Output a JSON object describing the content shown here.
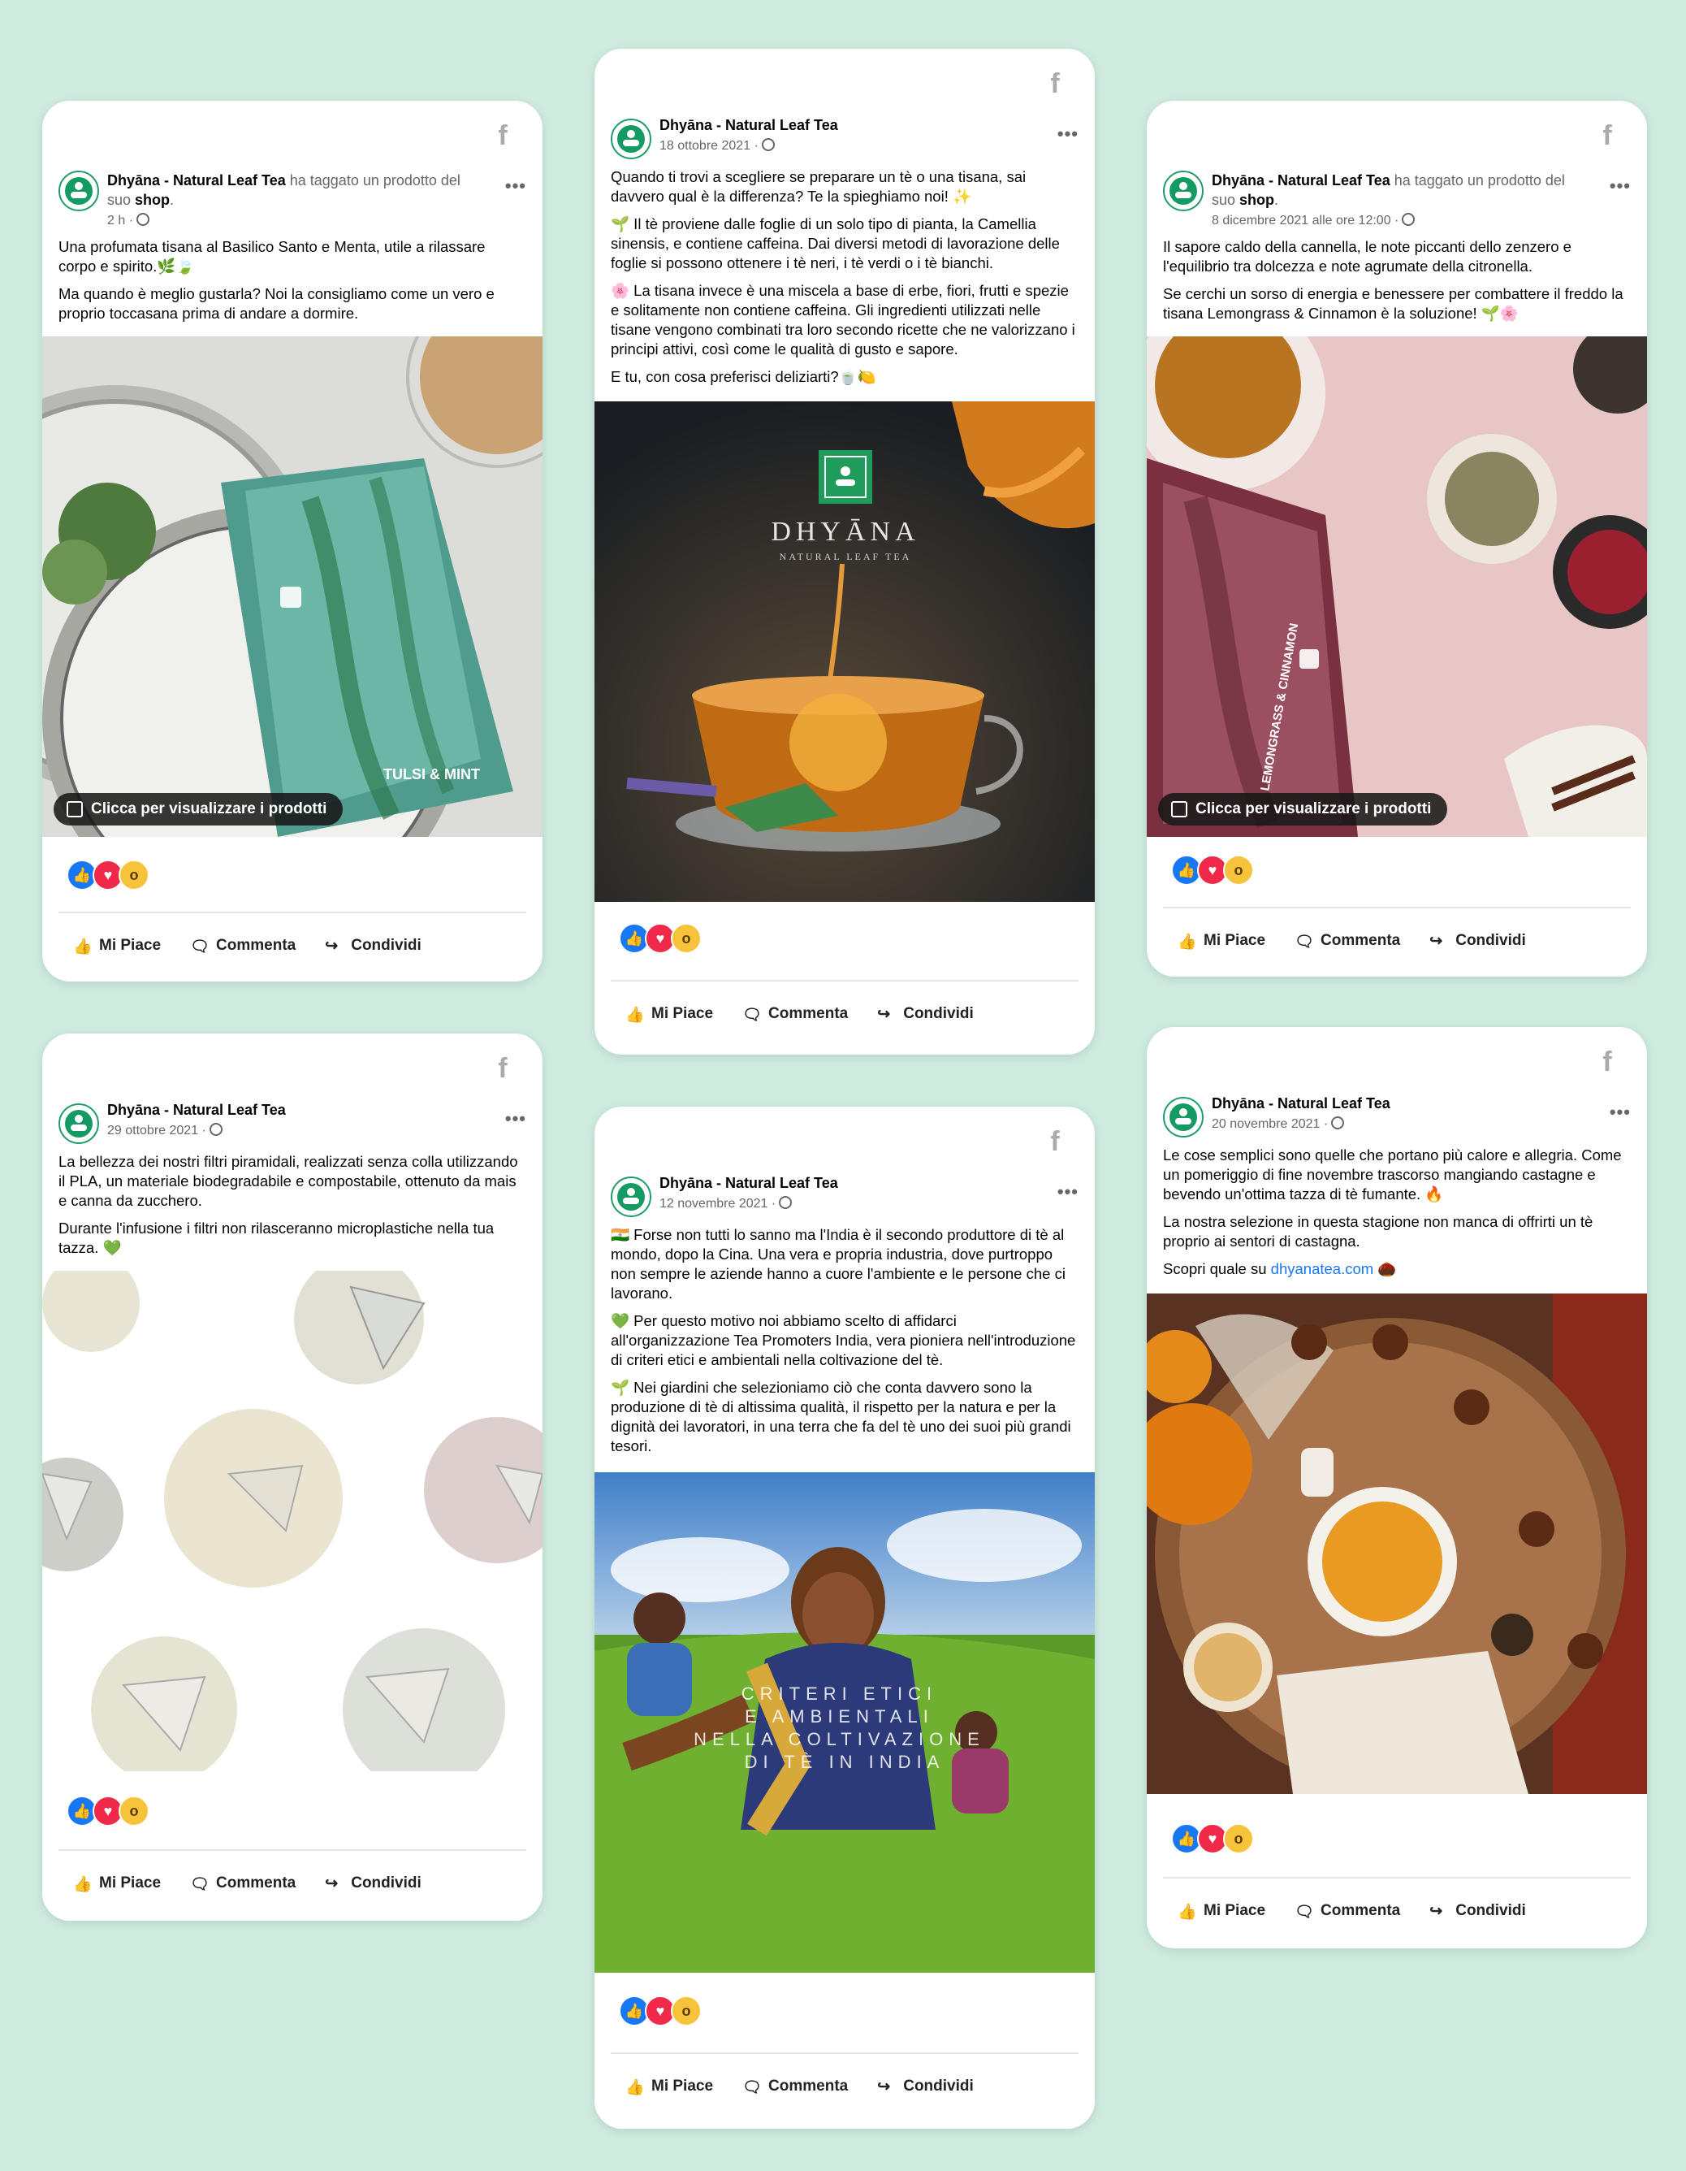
{
  "page_name": "Dhyāna - Natural Leaf Tea",
  "tagged_prefix": "ha taggato un prodotto del suo",
  "tagged_shop": "shop",
  "chip_label": "Clicca per visualizzare i prodotti",
  "actions": {
    "like": "Mi Piace",
    "comment": "Commenta",
    "share": "Condividi"
  },
  "icons": {
    "brand": "facebook-icon",
    "like": "thumbs-up-icon",
    "comment": "comment-bubble-icon",
    "share": "share-arrow-icon"
  },
  "colors": {
    "background": "#cdebde",
    "brand_green": "#159a63",
    "like_blue": "#1877f2",
    "love_red": "#f0284a",
    "link_blue": "#1877f2"
  },
  "posts": [
    {
      "date": "2 h",
      "paragraphs": [
        "Una profumata tisana al Basilico Santo e Menta, utile a rilassare corpo e spirito.🌿🍃",
        "Ma quando è meglio gustarla? Noi la consigliamo come un vero e proprio toccasana prima di andare a dormire."
      ],
      "image_desc": "tulsi-mint-package-photo",
      "package_text": "TULSI & MINT"
    },
    {
      "date": "18 ottobre 2021",
      "paragraphs": [
        "Quando ti trovi a scegliere se preparare un tè o una tisana, sai davvero qual è la differenza? Te la spieghiamo noi! ✨",
        "🌱 Il tè proviene dalle foglie di un solo tipo di pianta, la Camellia sinensis, e contiene caffeina. Dai diversi metodi di lavorazione delle foglie si possono ottenere i tè neri, i tè verdi o i tè bianchi.",
        "🌸 La tisana invece è una miscela a base di erbe, fiori, frutti e spezie e solitamente non contiene caffeina. Gli ingredienti utilizzati nelle tisane vengono combinati tra loro secondo ricette che ne valorizzano i principi attivi, così come le qualità di gusto e sapore.",
        "E tu, con cosa preferisci deliziarti?🍵🍋"
      ],
      "brand_logo": "DHYĀNA",
      "brand_sub": "NATURAL LEAF TEA"
    },
    {
      "date": "8 dicembre 2021 alle ore 12:00",
      "paragraphs": [
        "Il sapore caldo della cannella, le note piccanti dello zenzero e l'equilibrio tra dolcezza e note agrumate della citronella.",
        "Se cerchi un sorso di energia e benessere per combattere il freddo la tisana Lemongrass & Cinnamon è la soluzione! 🌱🌸"
      ],
      "package_text": "LEMONGRASS & CINNAMON"
    },
    {
      "date": "29 ottobre 2021",
      "paragraphs": [
        "La bellezza dei nostri filtri piramidali, realizzati senza colla utilizzando il PLA, un materiale biodegradabile e compostabile, ottenuto da mais e canna da zucchero.",
        "Durante l'infusione i filtri non rilasceranno microplastiche nella tua tazza. 💚"
      ]
    },
    {
      "date": "12 novembre 2021",
      "paragraphs": [
        "🇮🇳 Forse non tutti lo sanno ma l'India è il secondo produttore di tè al mondo, dopo la Cina. Una vera e propria industria, dove purtroppo non sempre le aziende hanno a cuore l'ambiente e le persone che ci lavorano.",
        "💚 Per questo motivo noi abbiamo scelto di affidarci all'organizzazione Tea Promoters India, vera pioniera nell'introduzione di criteri etici e ambientali nella coltivazione del tè.",
        "🌱 Nei giardini che selezioniamo ciò che conta davvero sono la produzione di tè di altissima qualità, il rispetto per la natura e per la dignità dei lavoratori, in una terra che fa del tè uno dei suoi più grandi tesori."
      ],
      "image_caption": "CRITERI ETICI E AMBIENTALI NELLA COLTIVAZIONE DI TÈ IN INDIA"
    },
    {
      "date": "20 novembre 2021",
      "paragraphs": [
        "Le cose semplici sono quelle che portano più calore e allegria. Come un pomeriggio di fine novembre trascorso mangiando castagne e bevendo un'ottima tazza di tè fumante. 🔥",
        "La nostra selezione in questa stagione non manca di offrirti un tè proprio ai sentori di castagna."
      ],
      "link_prefix": "Scopri quale su",
      "link_text": "dhyanatea.com",
      "link_suffix": "🌰"
    }
  ]
}
